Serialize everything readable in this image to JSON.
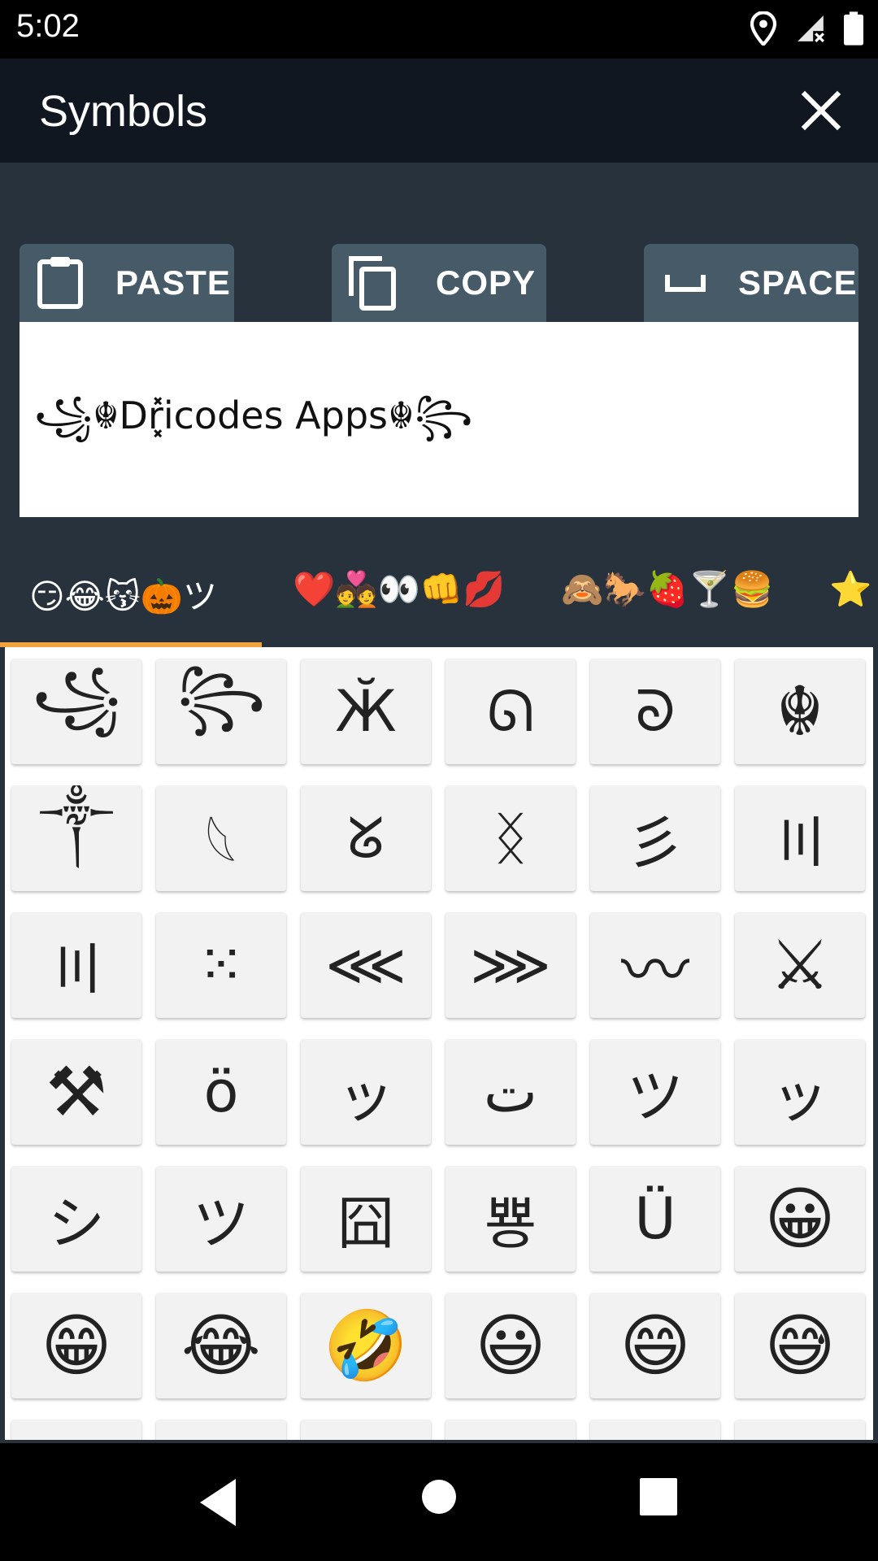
{
  "status_bar": {
    "time": "5:02",
    "icons": [
      "location-icon",
      "signal-no-data-icon",
      "battery-icon"
    ]
  },
  "app_bar": {
    "title": "Symbols",
    "close_icon": "close-icon"
  },
  "actions": {
    "paste_label": "PASTE",
    "copy_label": "COPY",
    "space_label": "SPACE"
  },
  "text_area": {
    "value": "꧁☬Dr͓̽icodes Apps☬꧂"
  },
  "category_tabs": [
    {
      "label": "😏😂😽🎃ツ",
      "selected": true
    },
    {
      "label": "❤️💑👀👊💋",
      "selected": false
    },
    {
      "label": "🙈🐎🍓🍸🍔",
      "selected": false
    },
    {
      "label": "⭐",
      "selected": false
    }
  ],
  "accent_color": "#f0a23c",
  "symbols": [
    "꧁",
    "꧂",
    "Ӂ",
    "ᘏ",
    "ᘐ",
    "☬",
    "༒",
    "𓆩",
    "ᘜ",
    "ᛝ",
    "彡",
    "〣",
    "〣",
    "⁙",
    "⋘",
    "⋙",
    "〰",
    "⚔",
    "⚒",
    "ö",
    "ッ",
    "ت",
    "ツ",
    "ッ",
    "シ",
    "ツ",
    "囧",
    "뿅",
    "Ü",
    "😀",
    "😁",
    "😂",
    "🤣",
    "😃",
    "😄",
    "😅",
    "",
    "",
    "",
    "",
    "",
    ""
  ],
  "nav": {
    "back_icon": "back-icon",
    "home_icon": "home-icon",
    "recents_icon": "recents-icon"
  }
}
